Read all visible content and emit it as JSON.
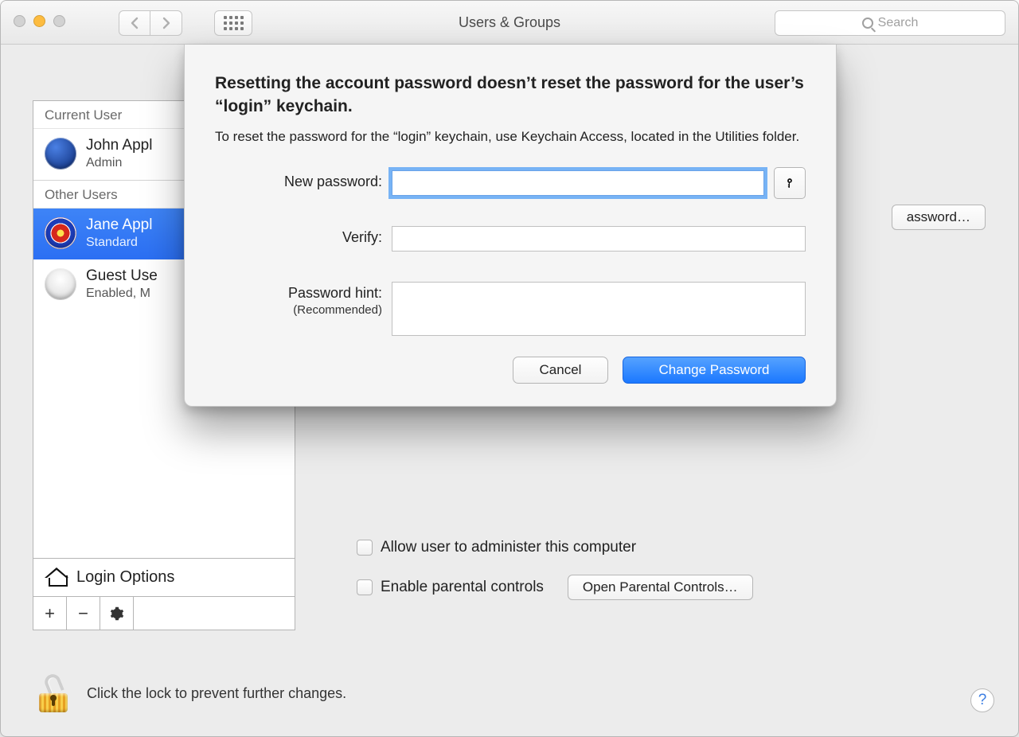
{
  "window": {
    "title": "Users & Groups",
    "search_placeholder": "Search"
  },
  "sidebar": {
    "section_current": "Current User",
    "section_other": "Other Users",
    "login_options_label": "Login Options",
    "users": [
      {
        "name": "John Appl",
        "sub": "Admin"
      },
      {
        "name": "Jane Appl",
        "sub": "Standard"
      },
      {
        "name": "Guest Use",
        "sub": "Enabled, M"
      }
    ]
  },
  "rightpane": {
    "reset_button": "assword…",
    "admin_checkbox_label": "Allow user to administer this computer",
    "parental_checkbox_label": "Enable parental controls",
    "open_parental_button": "Open Parental Controls…"
  },
  "lock_row": {
    "text": "Click the lock to prevent further changes."
  },
  "sheet": {
    "title": "Resetting the account password doesn’t reset the password for the user’s “login” keychain.",
    "subtitle": "To reset the password for the “login” keychain, use Keychain Access, located in the Utilities folder.",
    "label_new_password": "New password:",
    "label_verify": "Verify:",
    "label_hint": "Password hint:",
    "label_hint_rec": "(Recommended)",
    "btn_cancel": "Cancel",
    "btn_change": "Change Password",
    "values": {
      "new_password": "",
      "verify": "",
      "hint": ""
    }
  }
}
